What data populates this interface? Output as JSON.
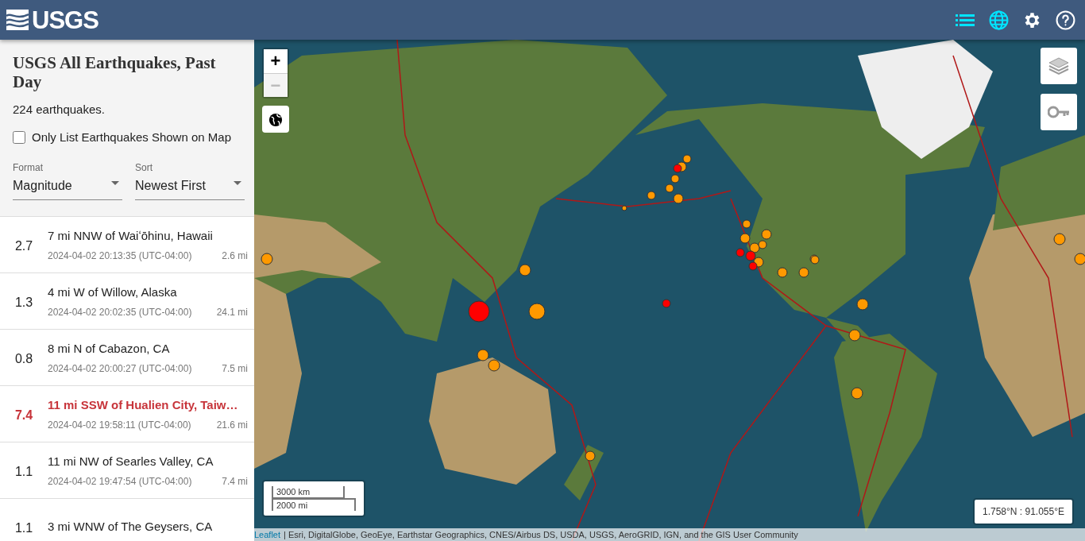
{
  "header": {
    "logo": "USGS",
    "nav": [
      {
        "kind": "list",
        "selected": true
      },
      {
        "kind": "map",
        "selected": true
      },
      {
        "kind": "settings",
        "selected": false
      },
      {
        "kind": "help",
        "selected": false
      }
    ]
  },
  "sidebar": {
    "title": "USGS All Earthquakes, Past Day",
    "count": "224 earthquakes.",
    "filter": {
      "label": "Only List Earthquakes Shown on Map",
      "checked": false
    },
    "selects": [
      {
        "label": "Format",
        "value": "Magnitude"
      },
      {
        "label": "Sort",
        "value": "Newest First"
      }
    ],
    "events": [
      {
        "magnitude": "2.7",
        "place": "7 mi NNW of Waiʻōhinu, Hawaii",
        "time": "2024-04-02 20:13:35 (UTC-04:00)",
        "depth": "2.6 mi",
        "significant": false
      },
      {
        "magnitude": "1.3",
        "place": "4 mi W of Willow, Alaska",
        "time": "2024-04-02 20:02:35 (UTC-04:00)",
        "depth": "24.1 mi",
        "significant": false
      },
      {
        "magnitude": "0.8",
        "place": "8 mi N of Cabazon, CA",
        "time": "2024-04-02 20:00:27 (UTC-04:00)",
        "depth": "7.5 mi",
        "significant": false
      },
      {
        "magnitude": "7.4",
        "place": "11 mi SSW of Hualien City, Taiw…",
        "time": "2024-04-02 19:58:11 (UTC-04:00)",
        "depth": "21.6 mi",
        "significant": true
      },
      {
        "magnitude": "1.1",
        "place": "11 mi NW of Searles Valley, CA",
        "time": "2024-04-02 19:47:54 (UTC-04:00)",
        "depth": "7.4 mi",
        "significant": false
      },
      {
        "magnitude": "1.1",
        "place": "3 mi WNW of The Geysers, CA",
        "significant": false
      }
    ]
  },
  "map": {
    "zoom": [
      {
        "label": "+",
        "disabled": false
      },
      {
        "label": "−",
        "disabled": true
      }
    ],
    "scale": [
      "3000 km",
      "2000 mi"
    ],
    "coordinates": "1.758°N : 91.055°E",
    "attribution": {
      "link": "Leaflet",
      "text": "| Esri, DigitalGlobe, GeoEye, Earthstar Geographics, CNES/Airbus DS, USDA, USGS, AeroGRID, IGN, and the GIS User Community"
    }
  }
}
